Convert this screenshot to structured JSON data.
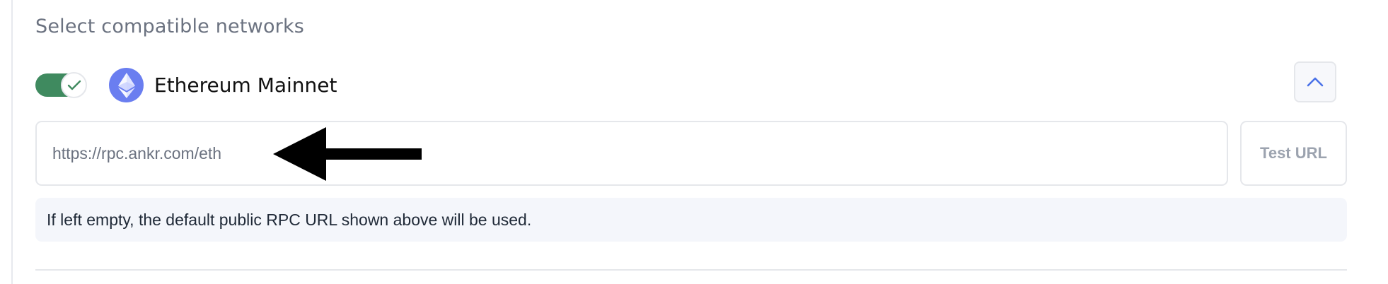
{
  "section": {
    "title": "Select compatible networks"
  },
  "network": {
    "enabled": true,
    "name": "Ethereum Mainnet",
    "logo_icon": "ethereum-icon",
    "collapse_icon": "chevron-up-icon"
  },
  "rpc": {
    "placeholder": "https://rpc.ankr.com/eth",
    "value": "",
    "test_label": "Test URL",
    "hint": "If left empty, the default public RPC URL shown above will be used."
  },
  "colors": {
    "toggle_on": "#3f8a5f",
    "eth_logo_bg": "#6a7ef0",
    "chevron": "#4a72e8",
    "annotation_arrow": "#000000"
  }
}
